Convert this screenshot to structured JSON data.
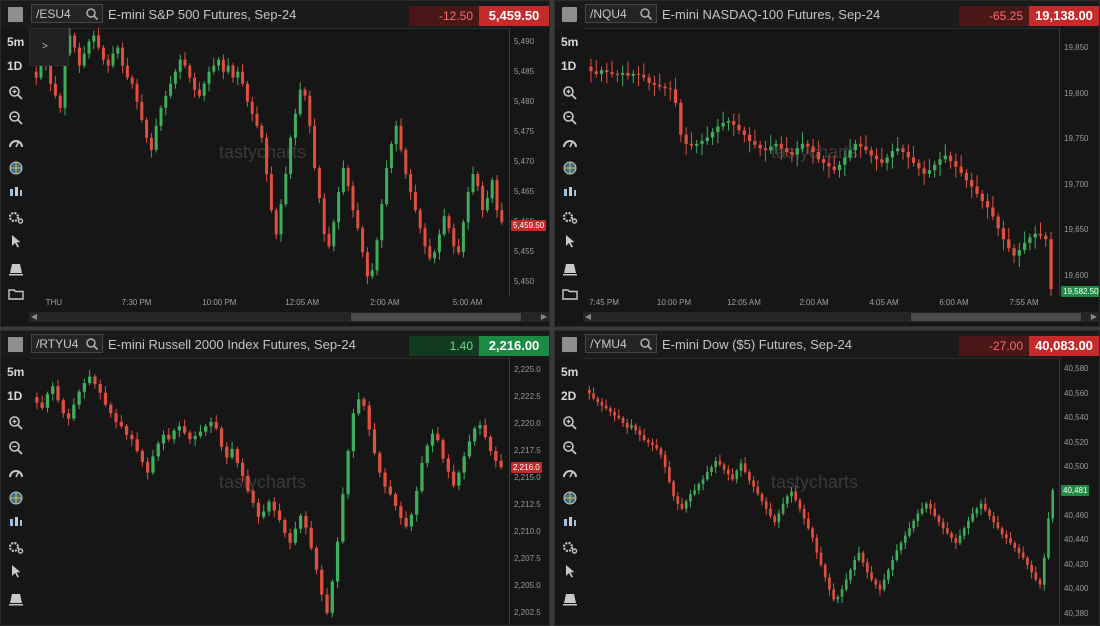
{
  "panels": [
    {
      "symbol": "/ESU4",
      "title": "E-mini S&P 500 Futures, Sep-24",
      "change": "-12.50",
      "last": "5,459.50",
      "direction": "neg",
      "timeframe": "5m",
      "range": "1D",
      "price_ticks": [
        "5,490",
        "5,485",
        "5,480",
        "5,475",
        "5,470",
        "5,465",
        "5,460",
        "5,455",
        "5,450"
      ],
      "price_label": "5,459.50",
      "time_ticks": [
        "THU",
        "7:30 PM",
        "10:00 PM",
        "12:05 AM",
        "2:00 AM",
        "5:00 AM"
      ],
      "watermark": "tastycharts",
      "series": [
        5485,
        5484,
        5486,
        5487,
        5483,
        5481,
        5479,
        5488,
        5491,
        5489,
        5486,
        5488,
        5490,
        5491,
        5489,
        5487,
        5486,
        5488,
        5489,
        5486,
        5484,
        5483,
        5480,
        5477,
        5474,
        5472,
        5476,
        5479,
        5481,
        5483,
        5485,
        5487,
        5486,
        5484,
        5482,
        5481,
        5483,
        5485,
        5486,
        5487,
        5485,
        5486,
        5484,
        5485,
        5483,
        5480,
        5478,
        5476,
        5474,
        5468,
        5462,
        5458,
        5463,
        5468,
        5474,
        5478,
        5482,
        5481,
        5476,
        5469,
        5464,
        5458,
        5456,
        5460,
        5465,
        5469,
        5466,
        5462,
        5459,
        5455,
        5451,
        5452,
        5457,
        5463,
        5469,
        5473,
        5476,
        5472,
        5468,
        5465,
        5462,
        5459,
        5456,
        5454,
        5455,
        5458,
        5461,
        5459,
        5456,
        5455,
        5460,
        5465,
        5468,
        5466,
        5462,
        5464,
        5467,
        5462,
        5460
      ]
    },
    {
      "symbol": "/NQU4",
      "title": "E-mini NASDAQ-100 Futures, Sep-24",
      "change": "-65.25",
      "last": "19,138.00",
      "direction": "neg",
      "timeframe": "5m",
      "range": "1D",
      "price_ticks": [
        "19,850",
        "19,800",
        "19,750",
        "19,700",
        "19,650",
        "19,600"
      ],
      "price_label": "19,582.50",
      "time_ticks": [
        "7:45 PM",
        "10:00 PM",
        "12:05 AM",
        "2:00 AM",
        "4:05 AM",
        "6:00 AM",
        "7:55 AM"
      ],
      "watermark": "tastycharts",
      "series": [
        19830,
        19825,
        19822,
        19826,
        19824,
        19822,
        19821,
        19823,
        19820,
        19822,
        19821,
        19818,
        19812,
        19810,
        19808,
        19806,
        19805,
        19790,
        19755,
        19745,
        19743,
        19745,
        19748,
        19752,
        19758,
        19764,
        19768,
        19770,
        19766,
        19760,
        19755,
        19748,
        19744,
        19740,
        19738,
        19742,
        19745,
        19740,
        19736,
        19733,
        19740,
        19745,
        19742,
        19736,
        19728,
        19724,
        19720,
        19716,
        19722,
        19730,
        19738,
        19745,
        19742,
        19738,
        19732,
        19728,
        19724,
        19730,
        19737,
        19740,
        19736,
        19730,
        19724,
        19718,
        19712,
        19716,
        19722,
        19728,
        19732,
        19726,
        19720,
        19713,
        19705,
        19698,
        19690,
        19682,
        19675,
        19665,
        19652,
        19640,
        19630,
        19622,
        19628,
        19636,
        19642,
        19646,
        19644,
        19640,
        19585
      ]
    },
    {
      "symbol": "/RTYU4",
      "title": "E-mini Russell 2000 Index Futures, Sep-24",
      "change": "1.40",
      "last": "2,216.00",
      "direction": "pos",
      "timeframe": "5m",
      "range": "1D",
      "price_ticks": [
        "2,225.0",
        "2,222.5",
        "2,220.0",
        "2,217.5",
        "2,215.0",
        "2,212.5",
        "2,210.0",
        "2,207.5",
        "2,205.0",
        "2,202.5"
      ],
      "price_label": "2,216.0",
      "time_ticks": [],
      "watermark": "tastycharts",
      "series": [
        2222.5,
        2222.0,
        2221.5,
        2222.8,
        2223.5,
        2222.2,
        2221.0,
        2220.5,
        2221.8,
        2223.0,
        2223.8,
        2224.4,
        2223.7,
        2222.9,
        2221.8,
        2221.0,
        2220.2,
        2219.8,
        2219.0,
        2218.6,
        2217.5,
        2216.5,
        2215.5,
        2217.0,
        2218.2,
        2219.0,
        2218.6,
        2219.4,
        2219.8,
        2219.2,
        2218.6,
        2218.9,
        2219.3,
        2219.8,
        2220.2,
        2219.6,
        2217.9,
        2216.9,
        2217.7,
        2216.4,
        2215.2,
        2213.8,
        2212.7,
        2211.4,
        2211.9,
        2212.8,
        2212.0,
        2211.1,
        2209.9,
        2209.0,
        2210.3,
        2211.5,
        2210.4,
        2208.5,
        2206.5,
        2204.2,
        2202.5,
        2205.4,
        2209.1,
        2213.5,
        2217.5,
        2221.0,
        2222.3,
        2221.7,
        2219.5,
        2217.3,
        2215.5,
        2214.2,
        2213.5,
        2212.4,
        2211.3,
        2210.5,
        2211.6,
        2213.8,
        2216.4,
        2218.0,
        2219.1,
        2218.5,
        2216.8,
        2215.6,
        2214.3,
        2215.5,
        2217.0,
        2218.4,
        2219.6,
        2219.9,
        2218.8,
        2217.5,
        2216.6,
        2216.0
      ]
    },
    {
      "symbol": "/YMU4",
      "title": "E-mini Dow ($5) Futures, Sep-24",
      "change": "-27.00",
      "last": "40,083.00",
      "direction": "neg",
      "timeframe": "5m",
      "range": "2D",
      "price_ticks": [
        "40,580",
        "40,560",
        "40,540",
        "40,520",
        "40,500",
        "40,480",
        "40,460",
        "40,440",
        "40,420",
        "40,400",
        "40,380"
      ],
      "price_label": "40,481",
      "time_ticks": [],
      "watermark": "tastycharts",
      "series": [
        40563,
        40560,
        40556,
        40553,
        40550,
        40548,
        40545,
        40542,
        40540,
        40536,
        40532,
        40534,
        40530,
        40526,
        40522,
        40520,
        40518,
        40515,
        40510,
        40500,
        40488,
        40476,
        40470,
        40466,
        40472,
        40478,
        40481,
        40486,
        40490,
        40496,
        40500,
        40505,
        40502,
        40498,
        40494,
        40490,
        40497,
        40503,
        40496,
        40489,
        40484,
        40478,
        40472,
        40466,
        40460,
        40455,
        40462,
        40470,
        40476,
        40480,
        40473,
        40466,
        40458,
        40450,
        40442,
        40430,
        40420,
        40410,
        40400,
        40392,
        40394,
        40400,
        40408,
        40416,
        40424,
        40430,
        40422,
        40414,
        40408,
        40404,
        40400,
        40408,
        40416,
        40424,
        40432,
        40438,
        40444,
        40450,
        40456,
        40462,
        40466,
        40470,
        40466,
        40460,
        40455,
        40450,
        40446,
        40442,
        40438,
        40444,
        40450,
        40456,
        40462,
        40466,
        40470,
        40465,
        40460,
        40455,
        40450,
        40445,
        40442,
        40438,
        40434,
        40430,
        40426,
        40420,
        40414,
        40408,
        40404,
        40426,
        40458,
        40481
      ]
    }
  ]
}
